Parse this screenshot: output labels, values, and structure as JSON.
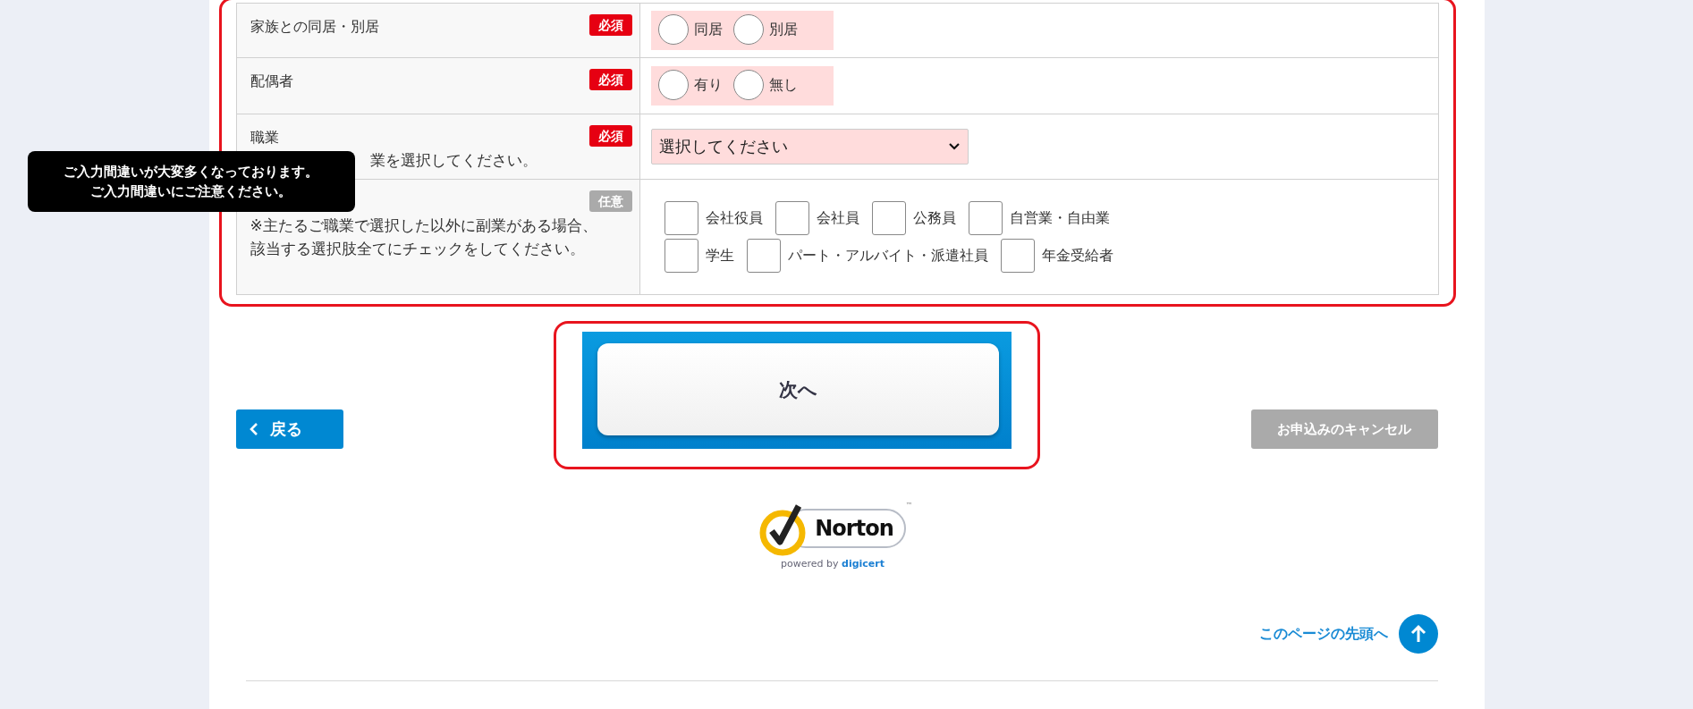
{
  "form": {
    "highlighted": true,
    "rows": [
      {
        "kind": "radio",
        "label": "家族との同居・別居",
        "badge": {
          "text": "必須",
          "kind": "required"
        },
        "invalid": true,
        "options": [
          {
            "label": "同居",
            "selected": false
          },
          {
            "label": "別居",
            "selected": false
          }
        ]
      },
      {
        "kind": "radio",
        "label": "配偶者",
        "badge": {
          "text": "必須",
          "kind": "required"
        },
        "invalid": true,
        "options": [
          {
            "label": "有り",
            "selected": false
          },
          {
            "label": "無し",
            "selected": false
          }
        ]
      },
      {
        "kind": "select",
        "label": "職業",
        "note": "業を選択してください。",
        "badge": {
          "text": "必須",
          "kind": "required"
        },
        "invalid": true,
        "placeholder": "選択してください"
      },
      {
        "kind": "checkbox",
        "note": "※主たるご職業で選択した以外に副業がある場合、該当する選択肢全てにチェックをしてください。",
        "badge": {
          "text": "任意",
          "kind": "optional"
        },
        "invalid": false,
        "option_lines": [
          [
            {
              "label": "会社役員",
              "checked": false
            },
            {
              "label": "会社員",
              "checked": false
            },
            {
              "label": "公務員",
              "checked": false
            },
            {
              "label": "自営業・自由業",
              "checked": false
            }
          ],
          [
            {
              "label": "学生",
              "checked": false
            },
            {
              "label": "パート・アルバイト・派遣社員",
              "checked": false
            },
            {
              "label": "年金受給者",
              "checked": false
            }
          ]
        ]
      }
    ]
  },
  "tooltip": {
    "lines": [
      "ご入力間違いが大変多くなっております。",
      "ご入力間違いにご注意ください。"
    ]
  },
  "buttons": {
    "back": "戻る",
    "next": {
      "label": "次へ",
      "highlighted": true
    },
    "cancel": {
      "label": "お申込みのキャンセル",
      "disabled": true
    }
  },
  "seal": {
    "name": "Norton",
    "tm": "™",
    "tagline": "powered by",
    "brand": "digicert"
  },
  "page_top": "このページの先頭へ"
}
